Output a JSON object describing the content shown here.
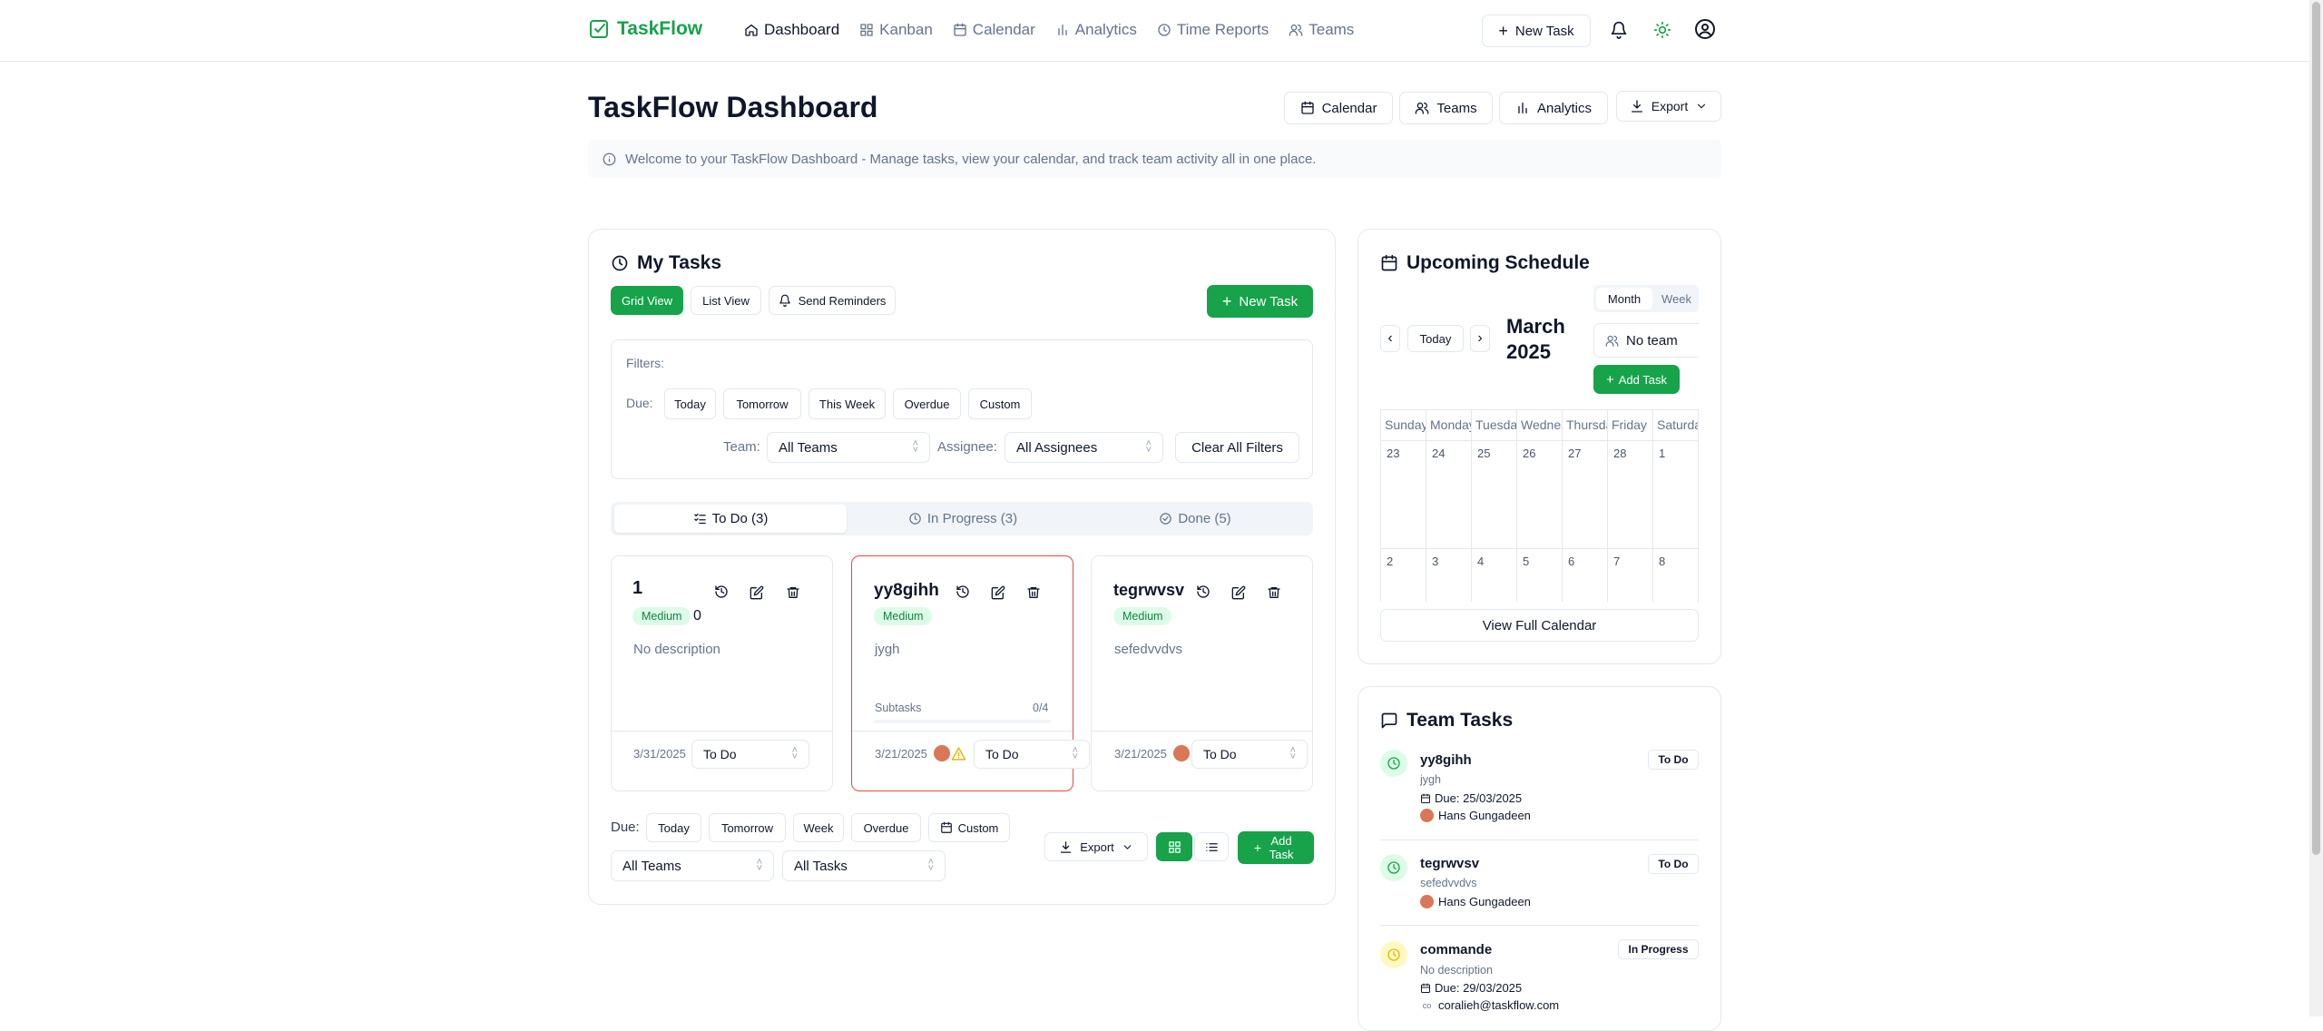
{
  "app": {
    "name": "TaskFlow"
  },
  "nav": {
    "items": [
      {
        "label": "Dashboard",
        "icon": "home-icon"
      },
      {
        "label": "Kanban",
        "icon": "kanban-icon"
      },
      {
        "label": "Calendar",
        "icon": "calendar-icon"
      },
      {
        "label": "Analytics",
        "icon": "bar-chart-icon"
      },
      {
        "label": "Time Reports",
        "icon": "clock-icon"
      },
      {
        "label": "Teams",
        "icon": "users-icon"
      }
    ],
    "new_task": "New Task"
  },
  "page": {
    "title": "TaskFlow Dashboard",
    "actions": {
      "calendar": "Calendar",
      "teams": "Teams",
      "analytics": "Analytics",
      "export": "Export"
    },
    "banner": "Welcome to your TaskFlow Dashboard - Manage tasks, view your calendar, and track team activity all in one place."
  },
  "my_tasks": {
    "title": "My Tasks",
    "grid_view": "Grid View",
    "list_view": "List View",
    "send_reminders": "Send Reminders",
    "new_task": "New Task",
    "filters": {
      "label": "Filters:",
      "due_label": "Due:",
      "due_options": [
        "Today",
        "Tomorrow",
        "This Week",
        "Overdue",
        "Custom"
      ],
      "team_label": "Team:",
      "team_value": "All Teams",
      "assignee_label": "Assignee:",
      "assignee_value": "All Assignees",
      "clear": "Clear All Filters"
    },
    "tabs": {
      "todo": "To Do (3)",
      "in_progress": "In Progress (3)",
      "done": "Done (5)"
    },
    "cards": [
      {
        "title": "1",
        "priority": "Medium",
        "extra": "0",
        "description": "No description",
        "date": "3/31/2025",
        "status": "To Do"
      },
      {
        "title": "yy8gihh",
        "priority": "Medium",
        "description": "jygh",
        "subtasks_label": "Subtasks",
        "subtasks_count": "0/4",
        "subtasks_progress": 0,
        "date": "3/21/2025",
        "status": "To Do"
      },
      {
        "title": "tegrwvsv",
        "priority": "Medium",
        "description": "sefedvvdvs",
        "date": "3/21/2025",
        "status": "To Do"
      }
    ],
    "bottom": {
      "due_label": "Due:",
      "due_options": [
        "Today",
        "Tomorrow",
        "Week",
        "Overdue"
      ],
      "custom": "Custom",
      "export": "Export",
      "add_task": "Add Task",
      "teams_value": "All Teams",
      "tasks_value": "All Tasks"
    }
  },
  "schedule": {
    "title": "Upcoming Schedule",
    "month_tab": "Month",
    "week_tab": "Week",
    "today": "Today",
    "month_line1": "March",
    "month_line2": "2025",
    "team": "No team",
    "add_task": "Add Task",
    "weekdays": [
      "Sunday",
      "Monday",
      "Tuesday",
      "Wednesday",
      "Thursday",
      "Friday",
      "Saturday"
    ],
    "week1": [
      "23",
      "24",
      "25",
      "26",
      "27",
      "28",
      "1"
    ],
    "week2": [
      "2",
      "3",
      "4",
      "5",
      "6",
      "7",
      "8"
    ],
    "view_full": "View Full Calendar"
  },
  "team_tasks": {
    "title": "Team Tasks",
    "items": [
      {
        "title": "yy8gihh",
        "desc": "jygh",
        "due": "Due: 25/03/2025",
        "assignee": "Hans Gungadeen",
        "status": "To Do"
      },
      {
        "title": "tegrwvsv",
        "desc": "sefedvvdvs",
        "assignee": "Hans Gungadeen",
        "status": "To Do"
      },
      {
        "title": "commande",
        "desc": "No description",
        "due": "Due: 29/03/2025",
        "assignee": "coralieh@taskflow.com",
        "status": "In Progress"
      }
    ]
  },
  "colors": {
    "brand": "#16a34a",
    "priority_bg": "#dcfce7",
    "overdue_border": "#ef4444",
    "pending_yellow": "#eab308"
  }
}
